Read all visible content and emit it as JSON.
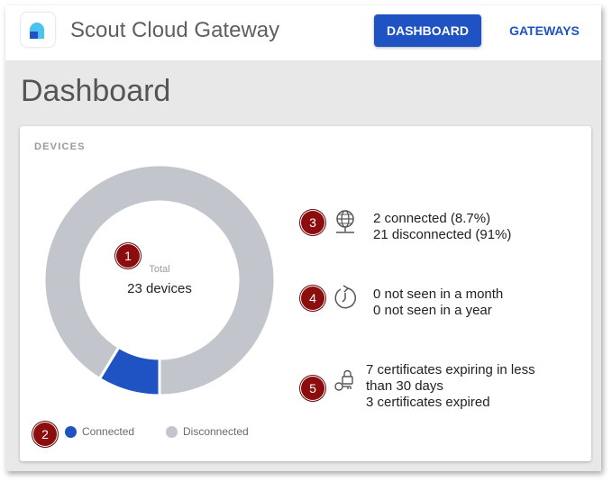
{
  "header": {
    "app_title": "Scout Cloud Gateway",
    "nav": {
      "dashboard": "DASHBOARD",
      "gateways": "GATEWAYS"
    },
    "accent_color": "#1f52c3"
  },
  "page": {
    "title": "Dashboard"
  },
  "devices_card": {
    "title": "DEVICES",
    "total_label": "Total",
    "total_value": "23 devices",
    "legend": {
      "connected": "Connected",
      "disconnected": "Disconnected"
    },
    "colors": {
      "connected": "#1f52c3",
      "disconnected": "#c2c5cc"
    },
    "stats": {
      "connectivity": {
        "icon": "globe-network-icon",
        "connected": "2 connected (8.7%)",
        "disconnected": "21 disconnected (91%)"
      },
      "last_seen": {
        "icon": "clock-history-icon",
        "month": "0 not seen in a month",
        "year": "0 not seen in a year"
      },
      "certificates": {
        "icon": "certificate-lock-icon",
        "expiring_line1": "7 certificates expiring in less",
        "expiring_line2": "than 30 days",
        "expired": "3 certificates expired"
      }
    }
  },
  "chart_data": {
    "type": "pie",
    "categories": [
      "Connected",
      "Disconnected"
    ],
    "values": [
      2,
      21
    ]
  },
  "callouts": {
    "c1": "1",
    "c2": "2",
    "c3": "3",
    "c4": "4",
    "c5": "5",
    "color": "#8b0d0d"
  }
}
